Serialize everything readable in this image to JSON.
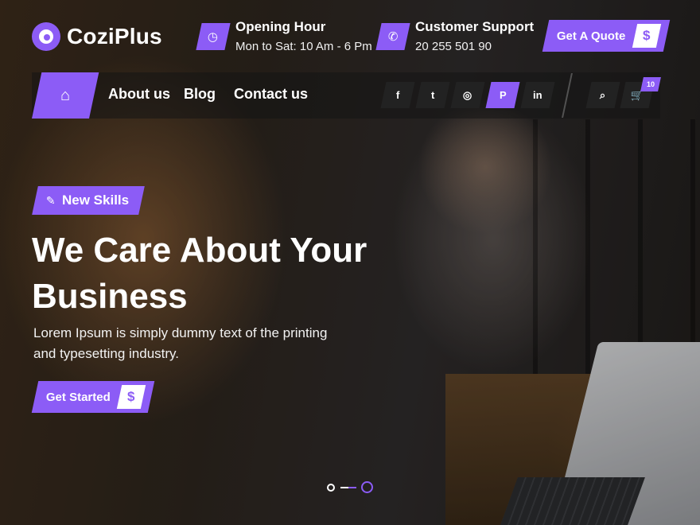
{
  "brand": {
    "name": "CoziPlus",
    "accent": "#8c5cf6"
  },
  "header": {
    "opening": {
      "icon": "clock-icon",
      "title": "Opening Hour",
      "value": "Mon to Sat: 10 Am - 6 Pm"
    },
    "support": {
      "icon": "phone-icon",
      "title": "Customer Support",
      "value": "20 255 501 90"
    },
    "quote_button": {
      "label": "Get A Quote",
      "icon": "dollar-icon",
      "glyph": "$"
    }
  },
  "nav": {
    "home_icon": "home-icon",
    "links": [
      "About us",
      "Blog",
      "Contact us"
    ],
    "social": [
      {
        "name": "facebook-icon",
        "glyph": "f"
      },
      {
        "name": "twitter-icon",
        "glyph": "t"
      },
      {
        "name": "instagram-icon",
        "glyph": "◎"
      },
      {
        "name": "pinterest-icon",
        "glyph": "P"
      },
      {
        "name": "linkedin-icon",
        "glyph": "in"
      }
    ],
    "search_icon": "search-icon",
    "cart_icon": "cart-icon",
    "cart_count": "10"
  },
  "hero": {
    "tag": {
      "icon": "pencil-icon",
      "label": "New Skills"
    },
    "headline": "We Care About Your Business",
    "description": "Lorem Ipsum is simply dummy text of the printing and typesetting industry.",
    "cta": {
      "label": "Get Started",
      "icon": "dollar-icon",
      "glyph": "$"
    }
  },
  "slider": {
    "current_slide": 2,
    "total_slides": 2
  }
}
